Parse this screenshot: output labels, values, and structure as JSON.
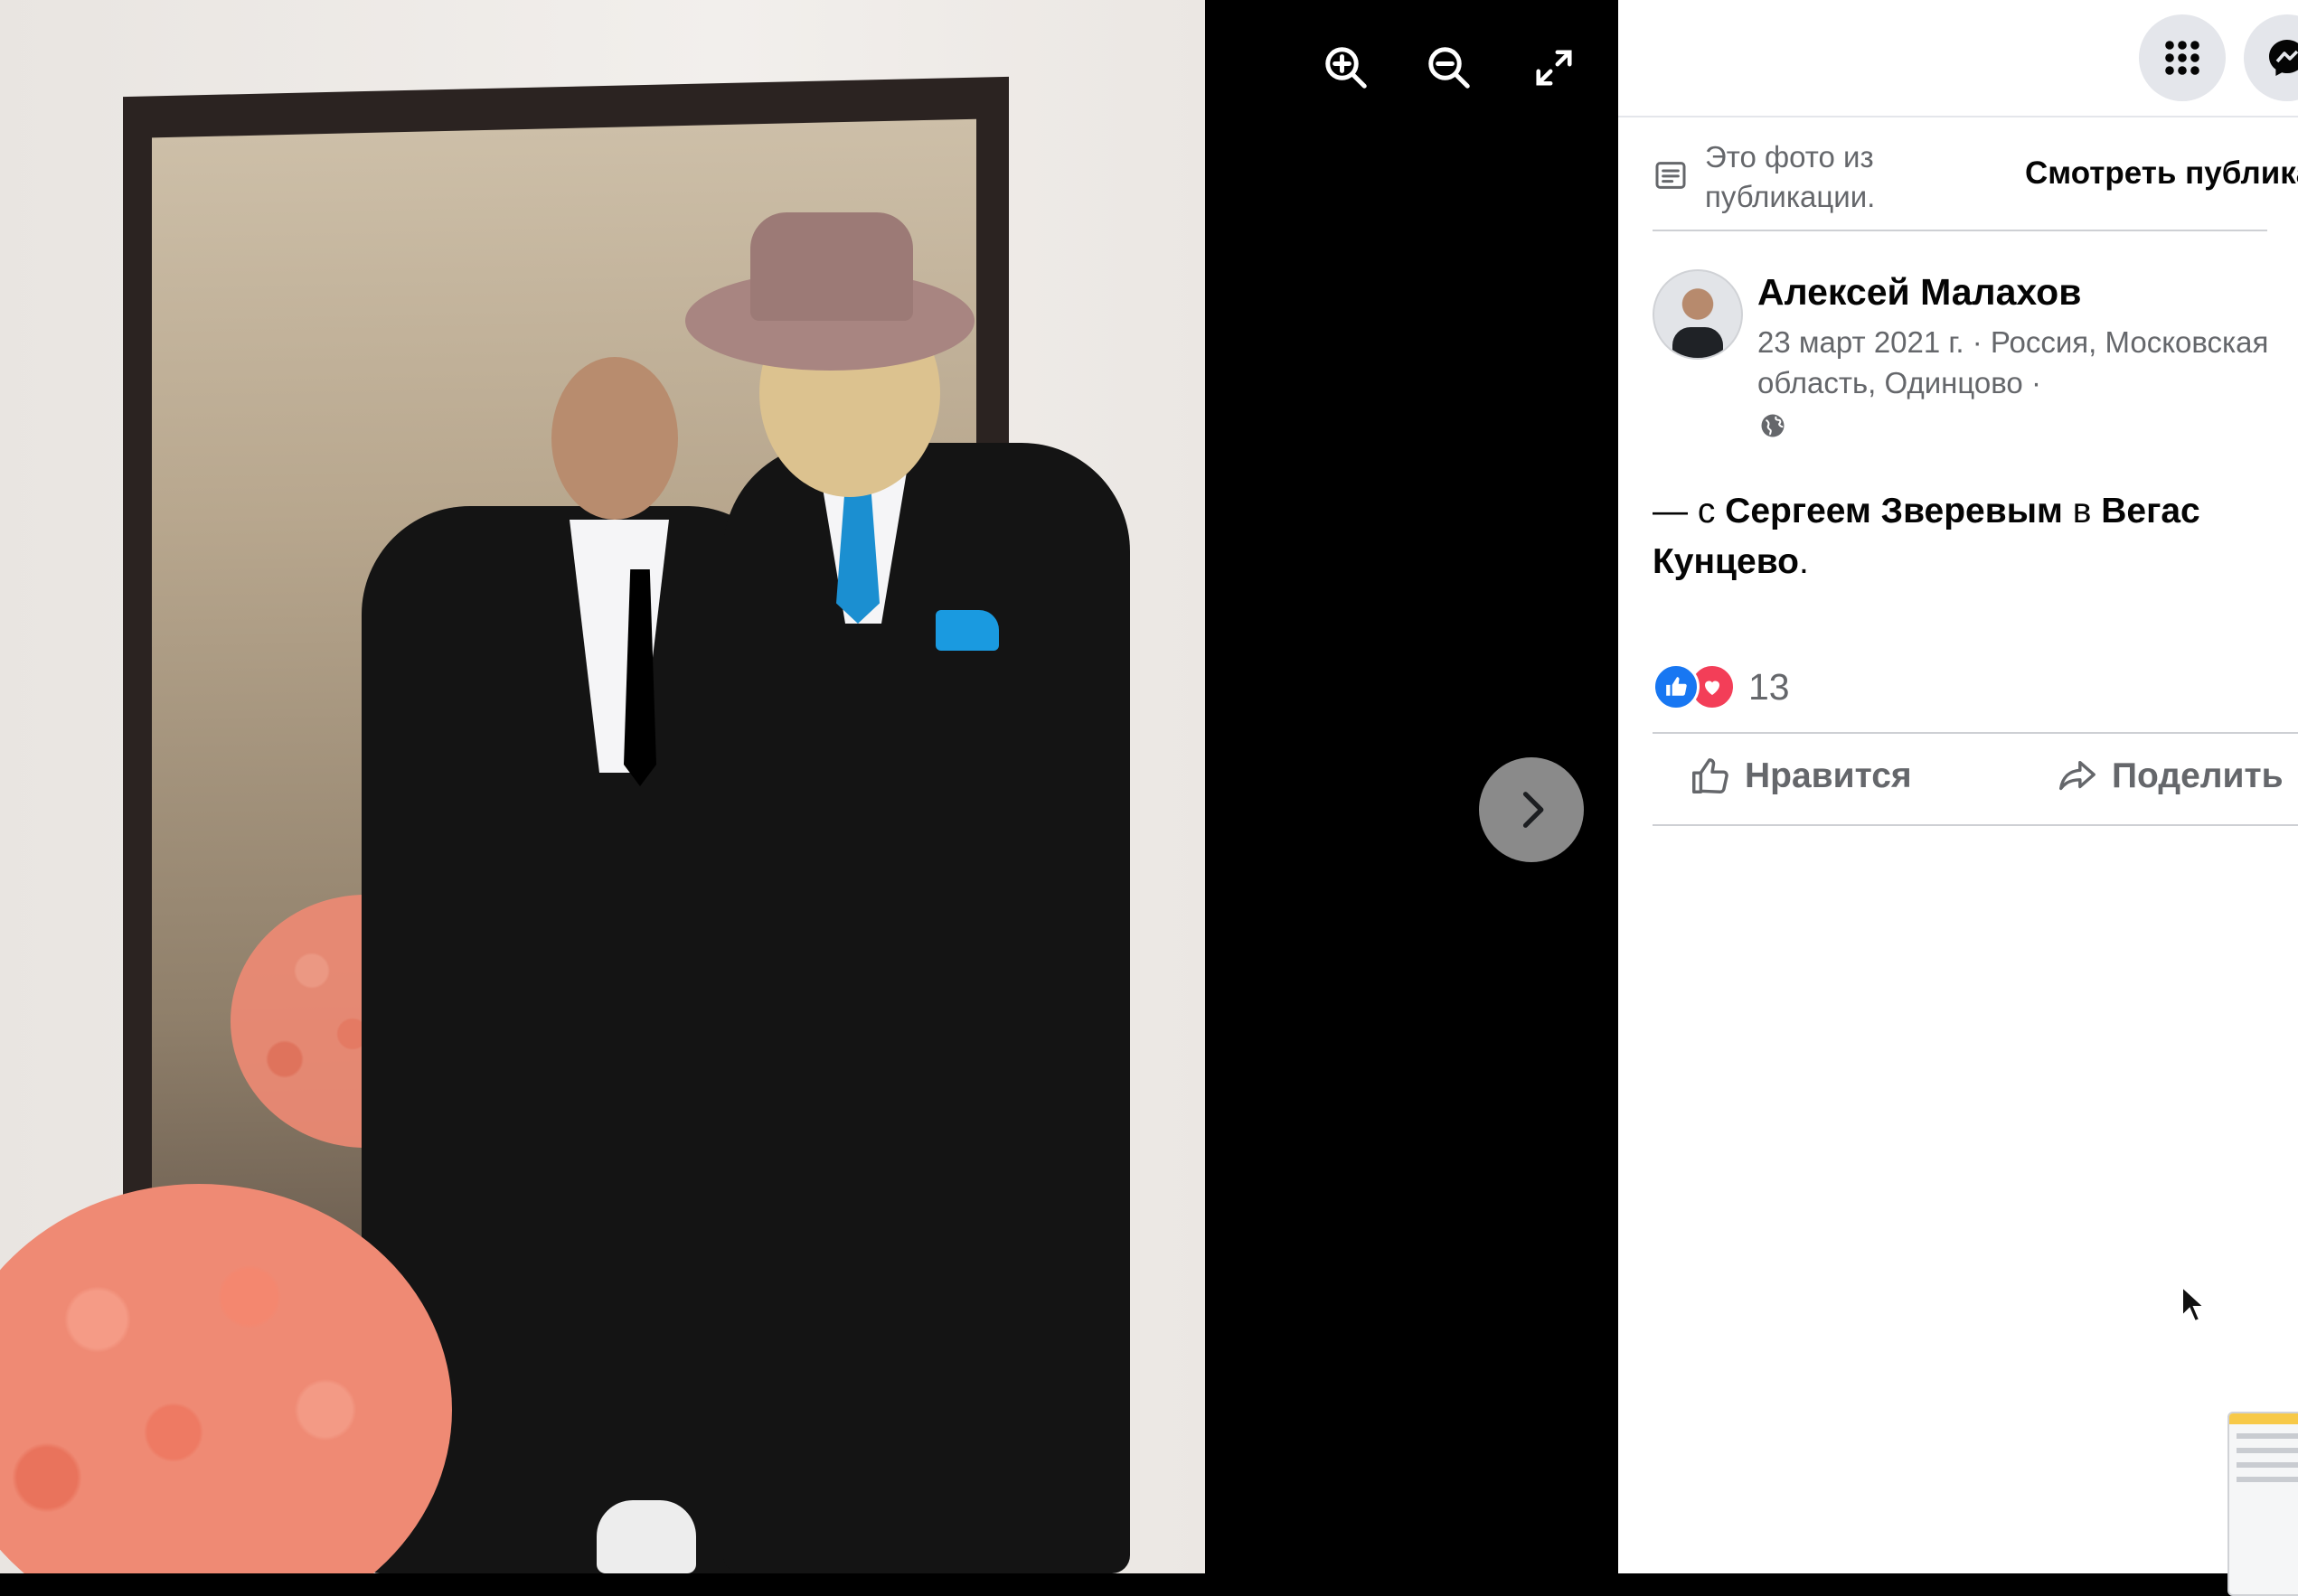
{
  "viewer": {
    "zoom_in_icon": "magnifier-plus-icon",
    "zoom_out_icon": "magnifier-minus-icon",
    "fullscreen_icon": "expand-arrows-icon",
    "next_icon": "chevron-right-icon"
  },
  "topbar": {
    "menu_icon": "grid-menu-icon",
    "messenger_icon": "messenger-icon"
  },
  "notice": {
    "icon": "document-icon",
    "text": "Это фото из публикации.",
    "view_link": "Смотреть публика"
  },
  "post": {
    "author": "Алексей Малахов",
    "date": "23 март 2021 г.",
    "sep1": " · ",
    "location": "Россия, Московская область, Одинцово",
    "sep2": " ·",
    "audience_icon": "globe-icon",
    "caption": {
      "prefix": "— с ",
      "tag_person": "Сергеем Зверевым",
      "middle": " в ",
      "tag_place": "Вегас Кунцево",
      "suffix": "."
    }
  },
  "reactions": {
    "count": "13",
    "types": [
      "like",
      "love"
    ]
  },
  "actions": {
    "like_label": "Нравится",
    "share_label": "Поделить"
  },
  "colors": {
    "accent": "#1877f2",
    "love": "#f33e58",
    "secondary_text": "#65676b",
    "primary_text": "#050505"
  }
}
